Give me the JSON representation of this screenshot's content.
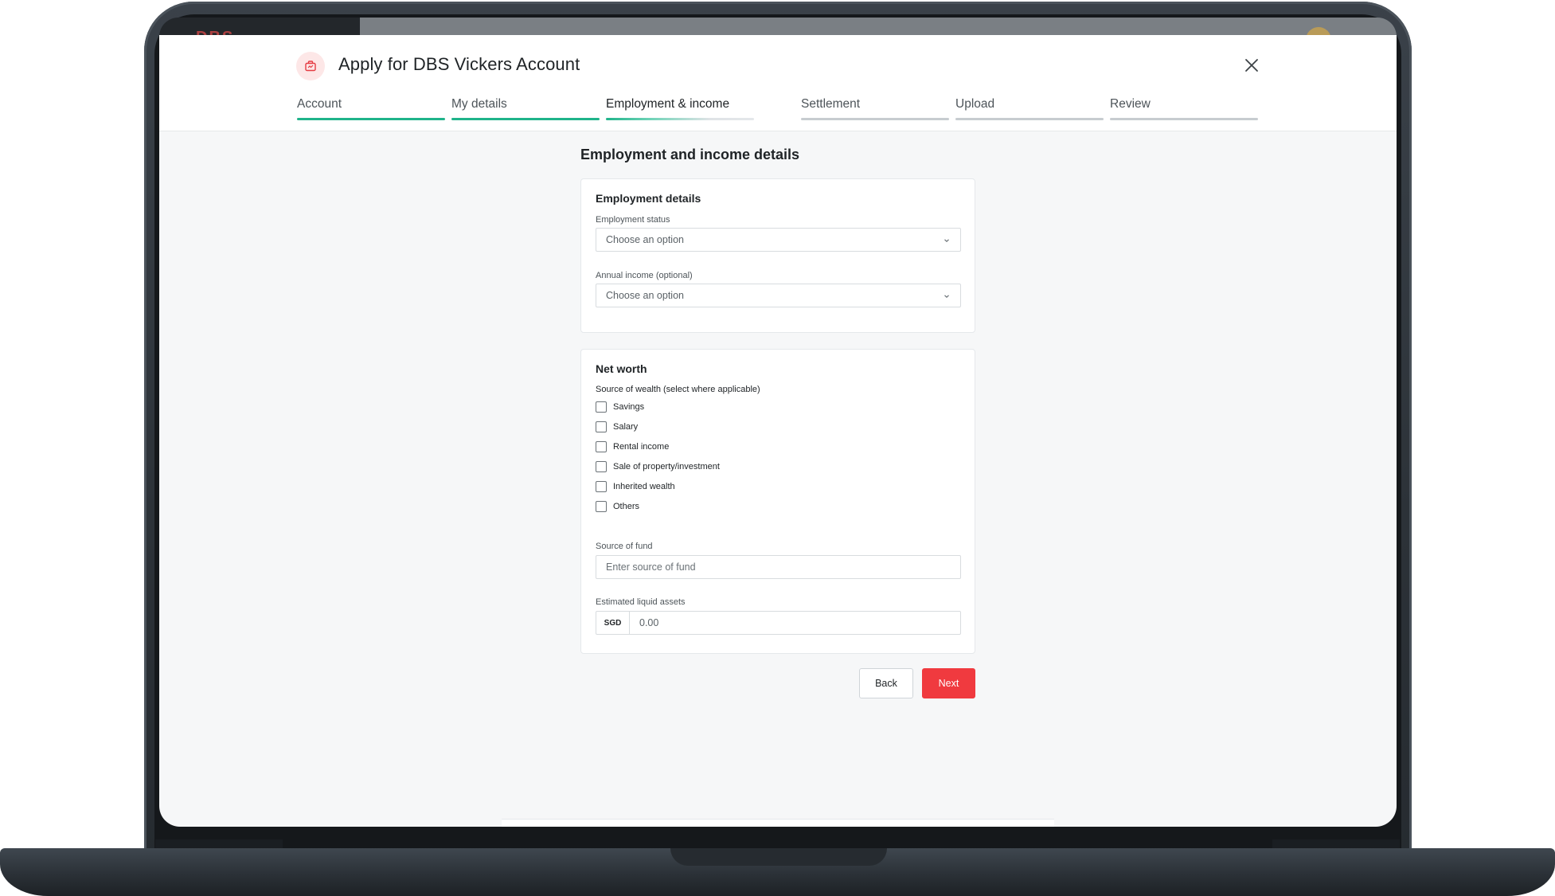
{
  "header": {
    "title": "Apply for DBS Vickers Account",
    "background_logo": "DBS"
  },
  "steps": [
    {
      "label": "Account",
      "state": "done"
    },
    {
      "label": "My details",
      "state": "done"
    },
    {
      "label": "Employment & income",
      "state": "current"
    },
    {
      "label": "Settlement",
      "state": "todo"
    },
    {
      "label": "Upload",
      "state": "todo"
    },
    {
      "label": "Review",
      "state": "todo"
    }
  ],
  "page": {
    "heading": "Employment and income details"
  },
  "employment": {
    "title": "Employment details",
    "status_label": "Employment status",
    "status_placeholder": "Choose an option",
    "income_label": "Annual income (optional)",
    "income_placeholder": "Choose an option"
  },
  "net_worth": {
    "title": "Net worth",
    "source_label": "Source of wealth (select where applicable)",
    "options": [
      "Savings",
      "Salary",
      "Rental income",
      "Sale of property/investment",
      "Inherited wealth",
      "Others"
    ],
    "fund_label": "Source of fund",
    "fund_placeholder": "Enter source of fund",
    "assets_label": "Estimated liquid assets",
    "currency": "SGD",
    "assets_value": "0.00"
  },
  "actions": {
    "back": "Back",
    "next": "Next"
  },
  "colors": {
    "accent_green": "#1fb38a",
    "primary_red": "#f03a3f"
  }
}
